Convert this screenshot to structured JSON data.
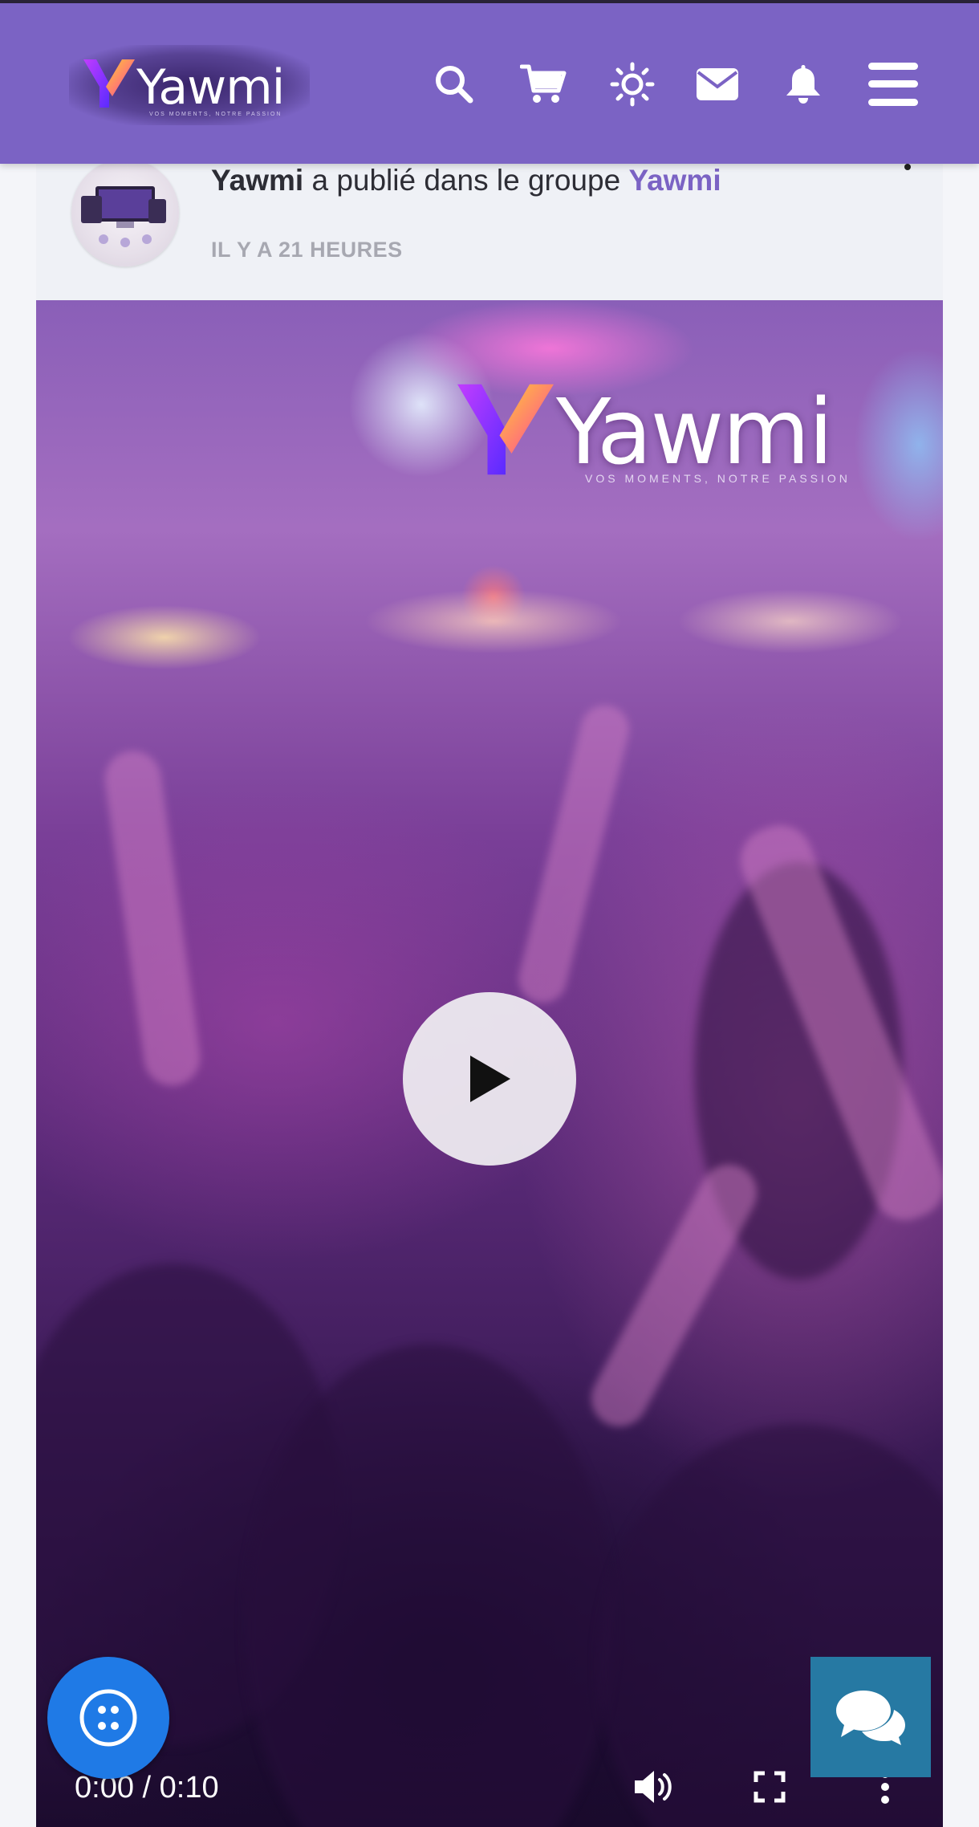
{
  "header": {
    "brand": "Yawmi",
    "brand_tagline": "VOS MOMENTS, NOTRE PASSION",
    "icons": [
      "search-icon",
      "cart-icon",
      "theme-toggle-icon",
      "mail-icon",
      "bell-icon",
      "menu-icon"
    ]
  },
  "post": {
    "author": "Yawmi",
    "action": " a publié dans le groupe ",
    "group": "Yawmi",
    "time": "IL Y A 21 HEURES"
  },
  "video": {
    "watermark_brand": "Yawmi",
    "watermark_tagline": "VOS MOMENTS, NOTRE PASSION",
    "time_display": "0:00 / 0:10",
    "controls": [
      "volume-icon",
      "fullscreen-icon",
      "more-options-icon"
    ]
  },
  "colors": {
    "header_bg": "#7b63c4",
    "accent_link": "#7b63c4",
    "fab_left": "#1f7ae6",
    "fab_right": "#2679a3"
  }
}
